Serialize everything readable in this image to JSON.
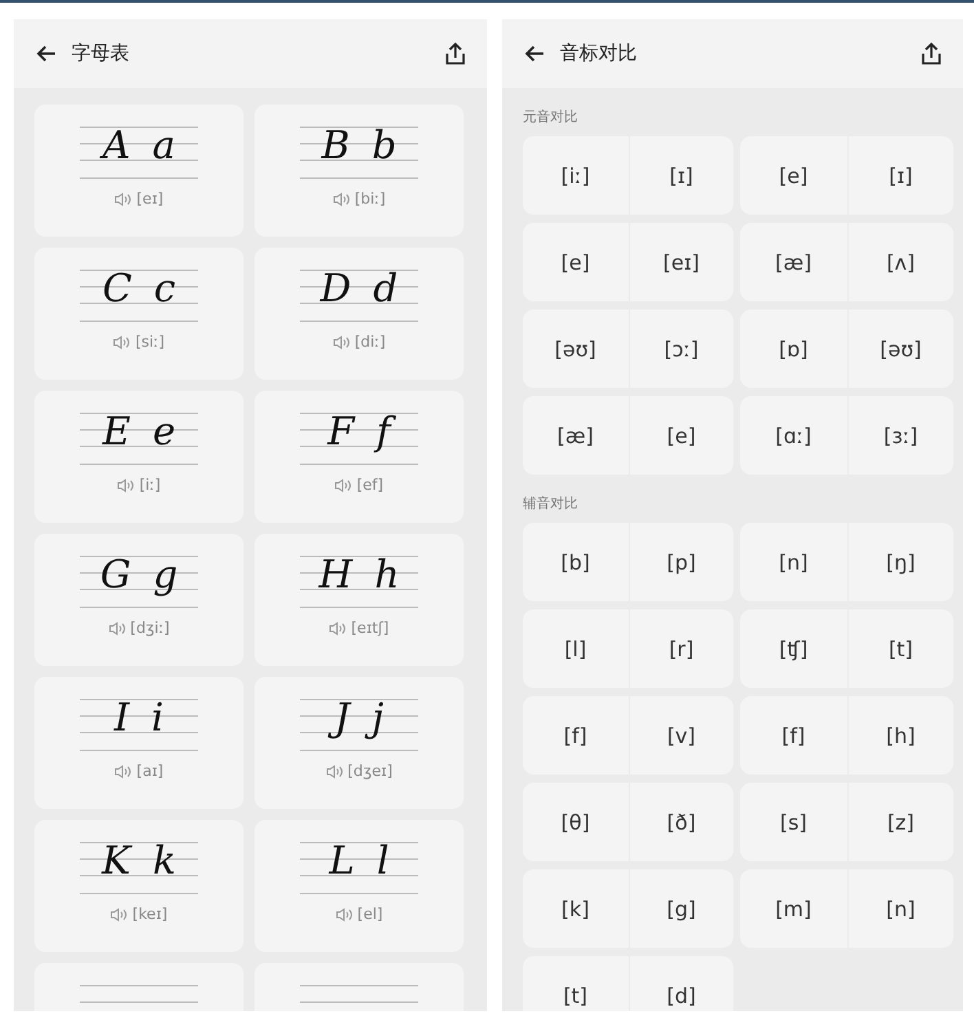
{
  "alphabet_screen": {
    "title": "字母表",
    "letters": [
      {
        "upper": "A",
        "lower": "a",
        "phonetic": "[eɪ]"
      },
      {
        "upper": "B",
        "lower": "b",
        "phonetic": "[biː]"
      },
      {
        "upper": "C",
        "lower": "c",
        "phonetic": "[siː]"
      },
      {
        "upper": "D",
        "lower": "d",
        "phonetic": "[diː]"
      },
      {
        "upper": "E",
        "lower": "e",
        "phonetic": "[iː]"
      },
      {
        "upper": "F",
        "lower": "f",
        "phonetic": "[ef]"
      },
      {
        "upper": "G",
        "lower": "g",
        "phonetic": "[dʒiː]"
      },
      {
        "upper": "H",
        "lower": "h",
        "phonetic": "[eɪtʃ]"
      },
      {
        "upper": "I",
        "lower": "i",
        "phonetic": "[aɪ]"
      },
      {
        "upper": "J",
        "lower": "j",
        "phonetic": "[dʒeɪ]"
      },
      {
        "upper": "K",
        "lower": "k",
        "phonetic": "[keɪ]"
      },
      {
        "upper": "L",
        "lower": "l",
        "phonetic": "[el]"
      },
      {
        "kind": "cut_off"
      },
      {
        "kind": "cut_off"
      }
    ]
  },
  "phonetics_screen": {
    "title": "音标对比",
    "sections": [
      {
        "label": "元音对比",
        "pairs": [
          [
            "[iː]",
            "[ɪ]"
          ],
          [
            "[e]",
            "[ɪ]"
          ],
          [
            "[e]",
            "[eɪ]"
          ],
          [
            "[æ]",
            "[ʌ]"
          ],
          [
            "[əʊ]",
            "[ɔː]"
          ],
          [
            "[ɒ]",
            "[əʊ]"
          ],
          [
            "[æ]",
            "[e]"
          ],
          [
            "[ɑː]",
            "[ɜː]"
          ]
        ]
      },
      {
        "label": "辅音对比",
        "pairs": [
          [
            "[b]",
            "[p]"
          ],
          [
            "[n]",
            "[ŋ]"
          ],
          [
            "[l]",
            "[r]"
          ],
          [
            "[ʧ]",
            "[t]"
          ],
          [
            "[f]",
            "[v]"
          ],
          [
            "[f]",
            "[h]"
          ],
          [
            "[θ]",
            "[ð]"
          ],
          [
            "[s]",
            "[z]"
          ],
          [
            "[k]",
            "[g]"
          ],
          [
            "[m]",
            "[n]"
          ],
          [
            "[t]",
            "[d]"
          ]
        ]
      }
    ]
  }
}
